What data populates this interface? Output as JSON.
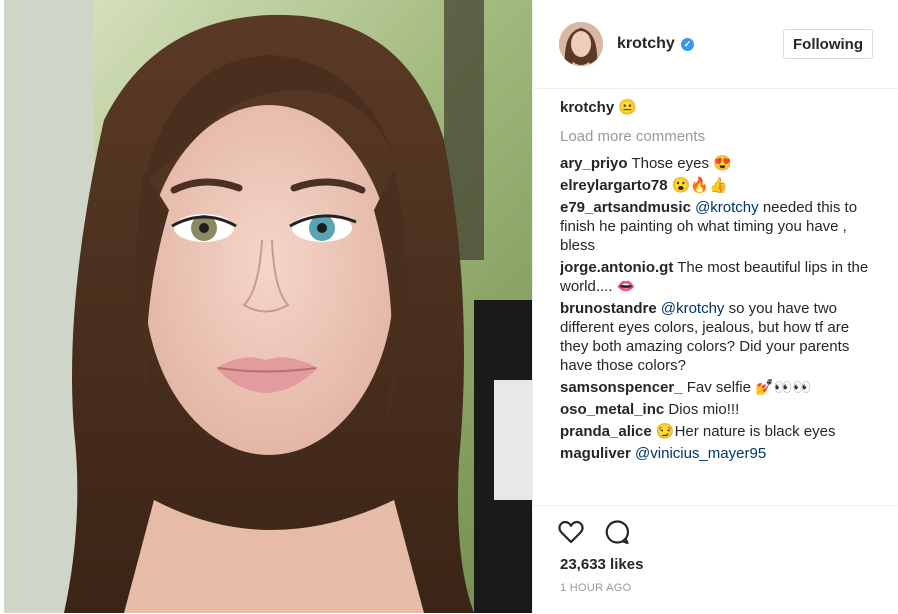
{
  "post": {
    "author": "krotchy",
    "follow_label": "Following",
    "caption_user": "krotchy",
    "caption_emoji": "😐",
    "load_more": "Load more comments",
    "likes": "23,633 likes",
    "time": "1 HOUR AGO"
  },
  "comments": [
    {
      "user": "ary_priyo",
      "text": "Those eyes 😍"
    },
    {
      "user": "elreylargarto78",
      "text": "😮🔥👍"
    },
    {
      "user": "e79_artsandmusic",
      "mention": "@krotchy",
      "text": "needed this to finish he painting oh what timing you have , bless"
    },
    {
      "user": "jorge.antonio.gt",
      "text": "The most beautiful lips in the world.... 👄"
    },
    {
      "user": "brunostandre",
      "mention": "@krotchy",
      "text": "so you have two different eyes colors, jealous, but how tf are they both amazing colors? Did your parents have those colors?"
    },
    {
      "user": "samsonspencer_",
      "text": "Fav selfie 💅👀👀"
    },
    {
      "user": "oso_metal_inc",
      "text": "Dios mio!!!"
    },
    {
      "user": "pranda_alice",
      "text": "😏Her nature is black eyes"
    },
    {
      "user": "maguliver",
      "mention": "@vinicius_mayer95",
      "text": ""
    }
  ],
  "icons": {
    "like": "heart-outline-icon",
    "comment": "speech-bubble-icon",
    "verified": "verified-badge-icon"
  },
  "colors": {
    "link": "#003569",
    "verified": "#3897f0",
    "muted": "#999999",
    "text": "#262626"
  }
}
